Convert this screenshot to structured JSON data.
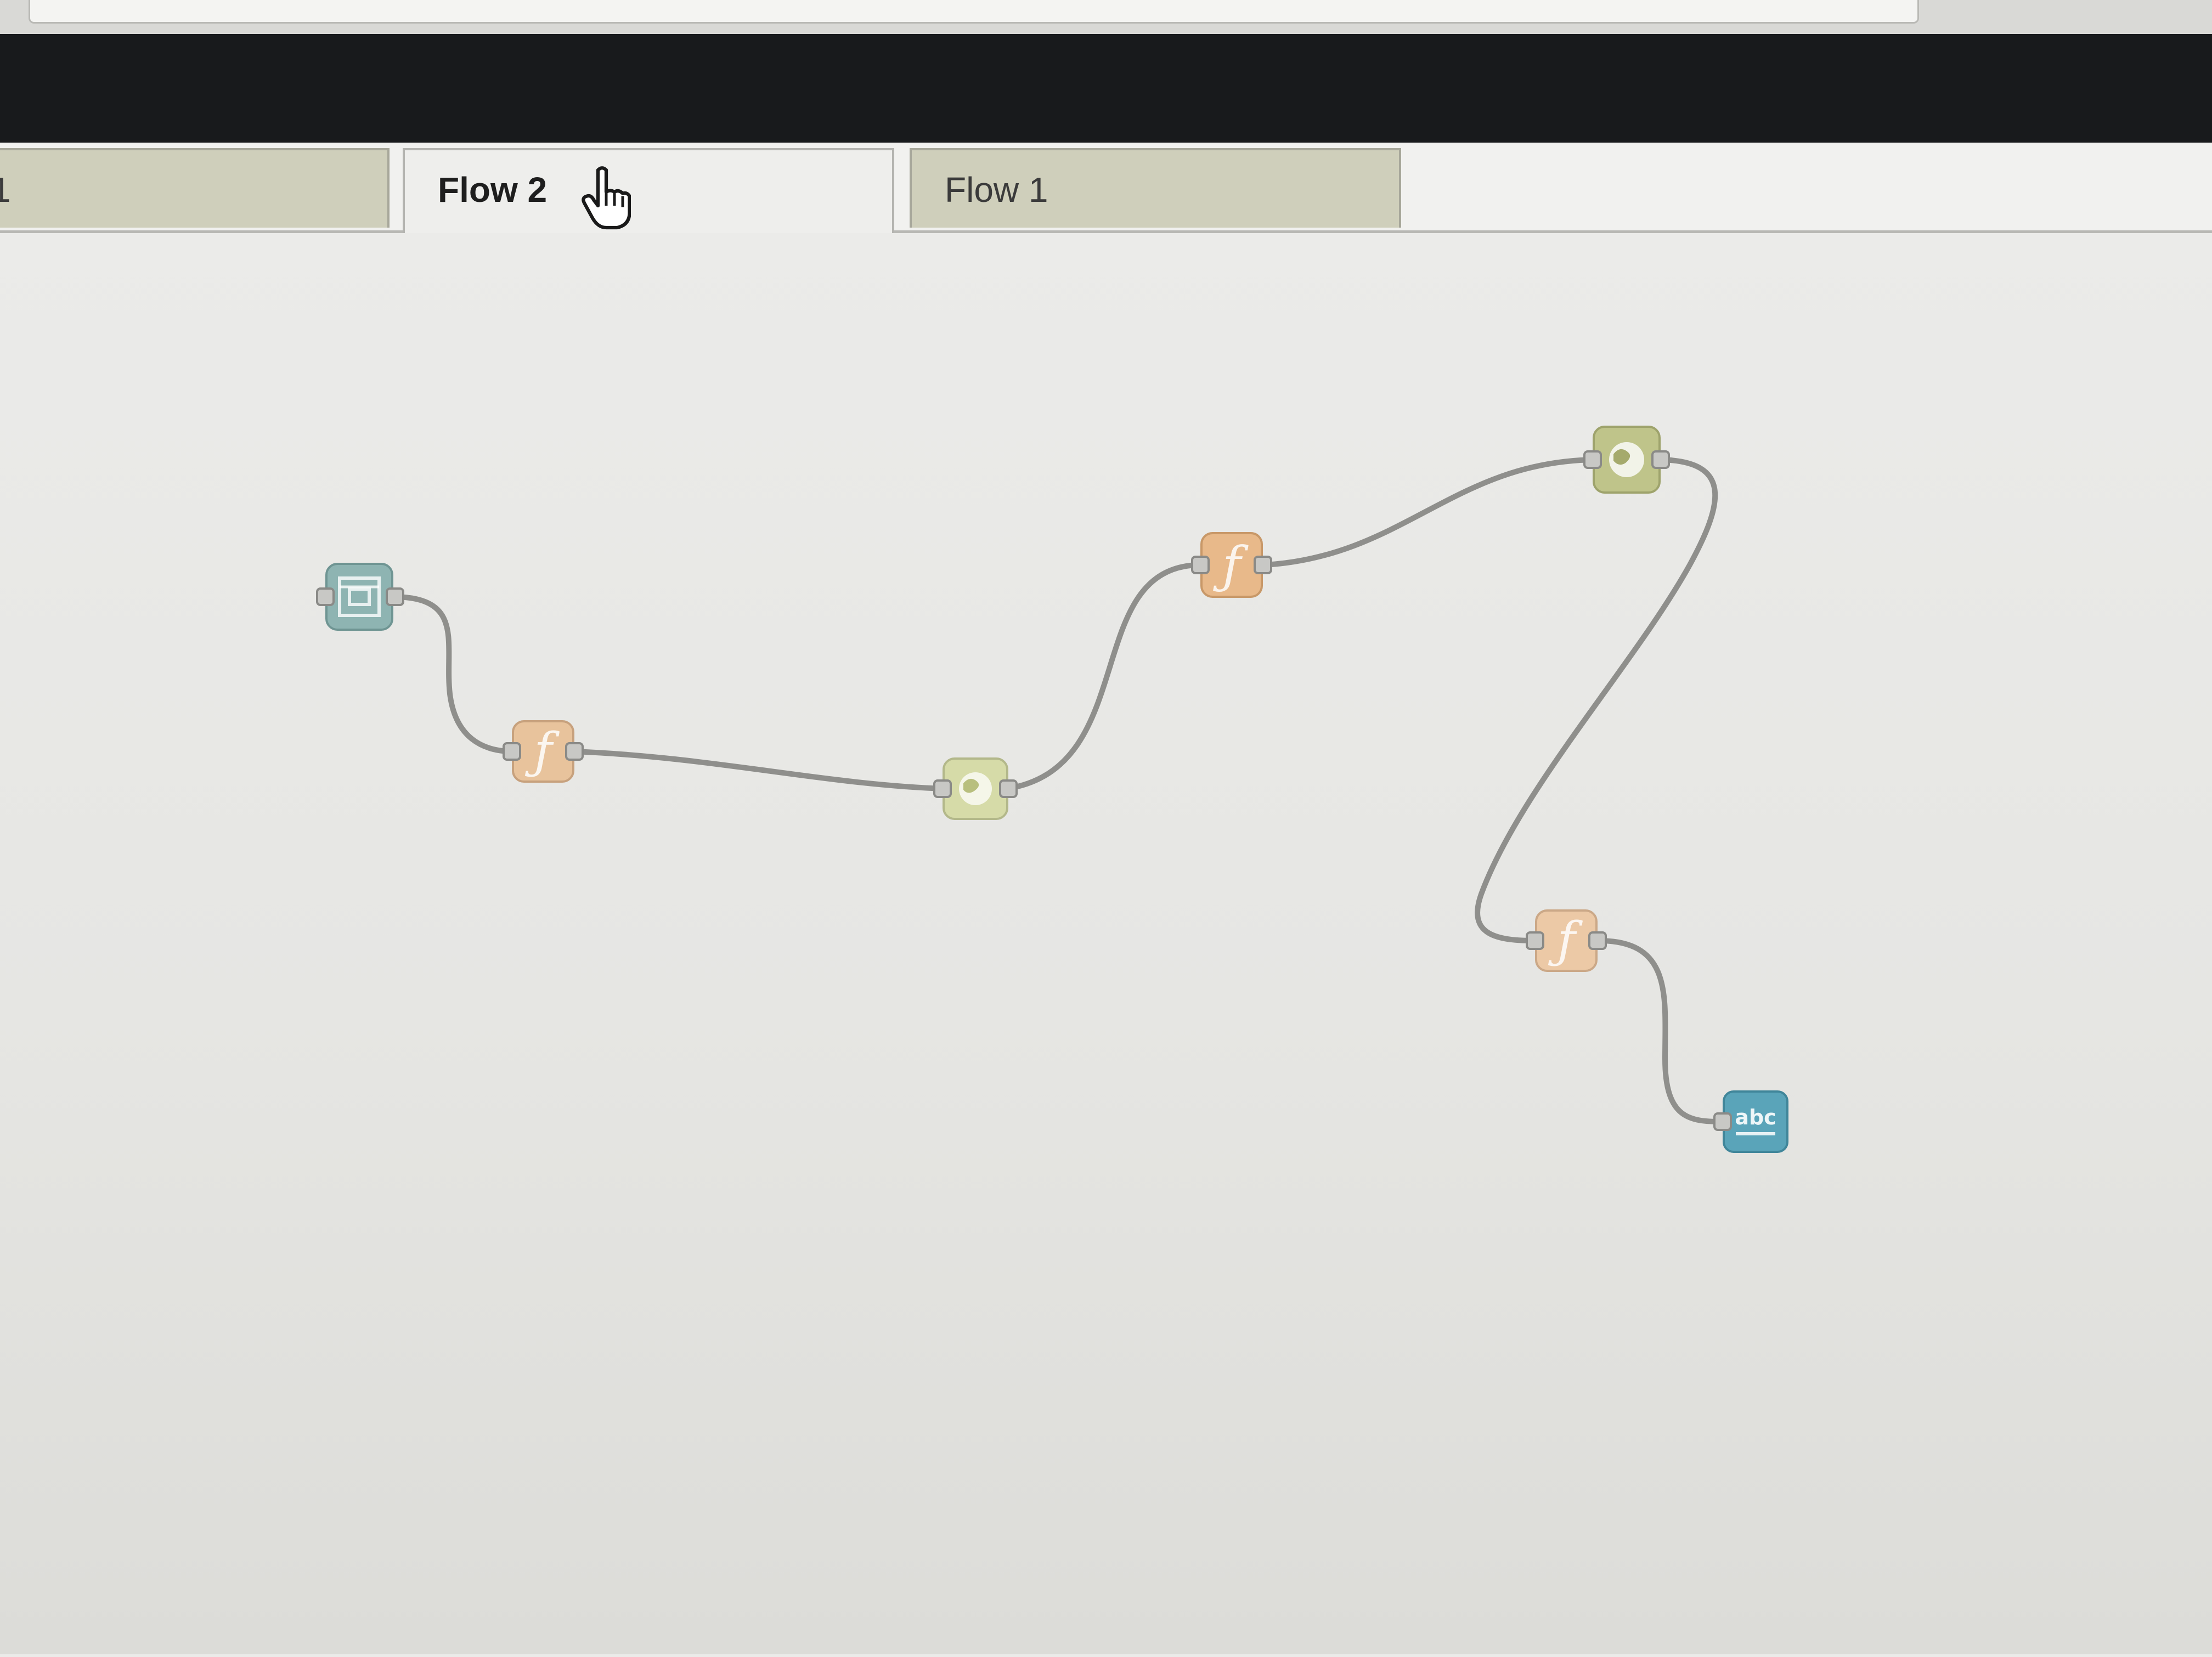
{
  "tabs": [
    {
      "label": "1",
      "state": "inactive-partial"
    },
    {
      "label": "Flow 2",
      "state": "active"
    },
    {
      "label": "Flow 1",
      "state": "inactive"
    }
  ],
  "workspace": {
    "nodes": [
      {
        "id": "n1",
        "kind": "inject",
        "icon": "inject-icon",
        "color": "#8eb4b2"
      },
      {
        "id": "n2",
        "kind": "function",
        "icon": "function-icon",
        "color": "#e8c39c"
      },
      {
        "id": "n3",
        "kind": "http-request",
        "icon": "globe-icon",
        "color": "#d6dba8"
      },
      {
        "id": "n4",
        "kind": "function",
        "icon": "function-icon",
        "color": "#e8b98a"
      },
      {
        "id": "n5",
        "kind": "http-request",
        "icon": "globe-icon",
        "color": "#bfc48a"
      },
      {
        "id": "n6",
        "kind": "function",
        "icon": "function-icon",
        "color": "#ecc9a6"
      },
      {
        "id": "n7",
        "kind": "template",
        "icon": "abc-icon",
        "label": "abc",
        "color": "#5aa4b9"
      }
    ],
    "wires": [
      [
        "n1",
        "n2"
      ],
      [
        "n2",
        "n3"
      ],
      [
        "n3",
        "n4"
      ],
      [
        "n4",
        "n5"
      ],
      [
        "n5",
        "n6"
      ],
      [
        "n6",
        "n7"
      ]
    ]
  },
  "colors": {
    "header": "#181a1c",
    "canvas": "#ebebe9",
    "tab_inactive": "#cfcfbb",
    "tab_active": "#eeeeec",
    "wire": "#8f8f8c"
  }
}
